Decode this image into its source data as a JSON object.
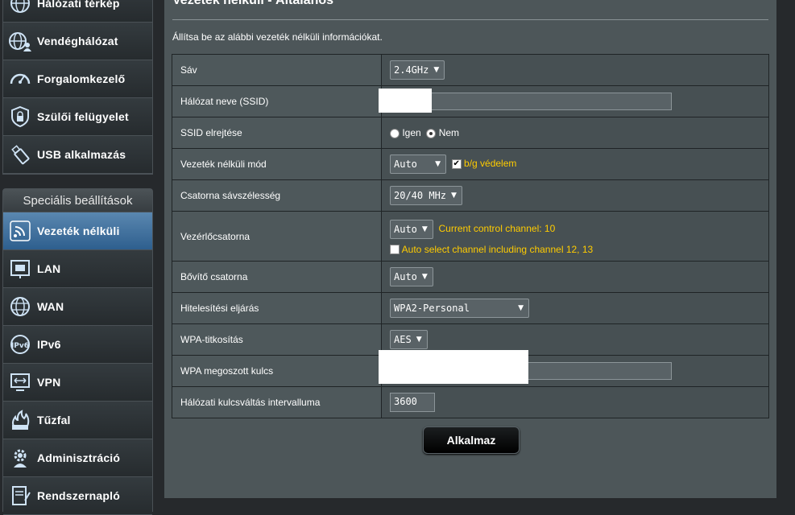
{
  "sidebar": {
    "top_items": [
      {
        "label": "Hálózati térkép",
        "icon": "globe-map-icon"
      },
      {
        "label": "Vendéghálózat",
        "icon": "guest-network-icon"
      },
      {
        "label": "Forgalomkezelő",
        "icon": "speedometer-icon"
      },
      {
        "label": "Szülői felügyelet",
        "icon": "parental-lock-icon"
      },
      {
        "label": "USB alkalmazás",
        "icon": "usb-icon"
      }
    ],
    "advanced_header": "Speciális beállítások",
    "advanced_items": [
      {
        "label": "Vezeték nélküli",
        "icon": "wifi-icon",
        "active": true
      },
      {
        "label": "LAN",
        "icon": "lan-icon"
      },
      {
        "label": "WAN",
        "icon": "wan-globe-icon"
      },
      {
        "label": "IPv6",
        "icon": "ipv6-icon"
      },
      {
        "label": "VPN",
        "icon": "vpn-icon"
      },
      {
        "label": "Tűzfal",
        "icon": "firewall-icon"
      },
      {
        "label": "Adminisztráció",
        "icon": "admin-gear-icon"
      },
      {
        "label": "Rendszernapló",
        "icon": "system-log-icon"
      }
    ]
  },
  "main": {
    "title": "Vezeték nélküli - Általános",
    "description": "Állítsa be az alábbi vezeték nélküli információkat.",
    "fields": {
      "band": {
        "label": "Sáv",
        "value": "2.4GHz"
      },
      "ssid": {
        "label": "Hálózat neve (SSID)",
        "value": ""
      },
      "hide_ssid": {
        "label": "SSID elrejtése",
        "yes": "Igen",
        "no": "Nem",
        "selected": "Nem"
      },
      "wireless_mode": {
        "label": "Vezeték nélküli mód",
        "value": "Auto",
        "bg_protection_label": "b/g védelem",
        "bg_protection_checked": true
      },
      "bandwidth": {
        "label": "Csatorna sávszélesség",
        "value": "20/40 MHz"
      },
      "control_channel": {
        "label": "Vezérlőcsatorna",
        "value": "Auto",
        "current_text": "Current control channel: 10",
        "auto_select_label": "Auto select channel including channel 12, 13",
        "auto_select_checked": false
      },
      "extension_channel": {
        "label": "Bővítő csatorna",
        "value": "Auto"
      },
      "auth_method": {
        "label": "Hitelesítési eljárás",
        "value": "WPA2-Personal"
      },
      "wpa_encryption": {
        "label": "WPA-titkosítás",
        "value": "AES"
      },
      "wpa_key": {
        "label": "WPA megoszott kulcs",
        "value": ""
      },
      "key_rotation": {
        "label": "Hálózati kulcsváltás intervalluma",
        "value": "3600"
      }
    },
    "apply_label": "Alkalmaz"
  },
  "colors": {
    "accent_orange": "#ffcc00",
    "active_menu": "#3f6e9c",
    "panel_bg": "#4d5659"
  }
}
